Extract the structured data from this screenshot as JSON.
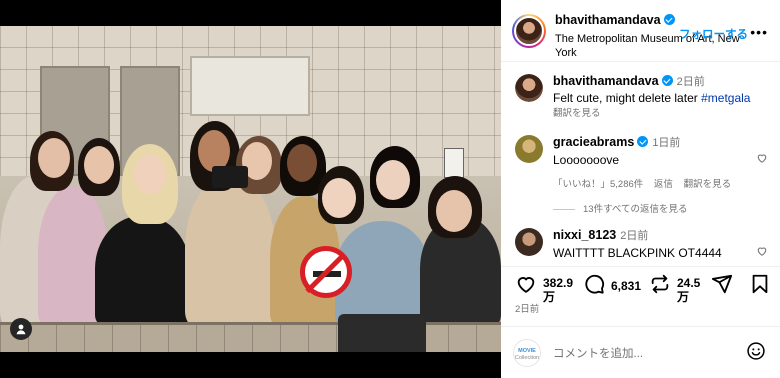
{
  "post": {
    "username": "bhavithamandava",
    "location": "The Metropolitan Museum of Art, New York",
    "follow_label": "フォローする",
    "caption_time": "2日前",
    "caption_text": "Felt cute, might delete later",
    "caption_hashtag": "#metgala",
    "see_translation": "翻訳を見る",
    "no_smoking_sign": "no-smoking-sign"
  },
  "comments": [
    {
      "username": "gracieabrams",
      "time": "1日前",
      "text": "Looooooove",
      "likes": "「いいね！」5,286件",
      "reply": "返信",
      "translate": "翻訳を見る",
      "avatar_color": "#8a7a2e"
    },
    {
      "username": "nixxi_8123",
      "time": "2日前",
      "text": "WAITTTT BLACKPINK OT4444",
      "avatar_color": "#3b2a20"
    }
  ],
  "replies_link": "13件すべての返信を見る",
  "actions": {
    "like_count_line1": "382.9",
    "like_count_line2": "万",
    "comment_count": "6,831",
    "repost_count_line1": "24.5",
    "repost_count_line2": "万",
    "like_icon": "heart-icon",
    "comment_icon": "comment-icon",
    "repost_icon": "repost-icon",
    "share_icon": "share-icon",
    "save_icon": "bookmark-icon"
  },
  "post_date": "2日前",
  "add_comment": {
    "placeholder": "コメントを追加...",
    "logo_text_1": "MOVIE",
    "logo_text_2": "Collection",
    "emoji_icon": "emoji-icon"
  },
  "colors": {
    "accent": "#0095f6",
    "hashtag": "#0037a9",
    "muted": "#737373"
  }
}
